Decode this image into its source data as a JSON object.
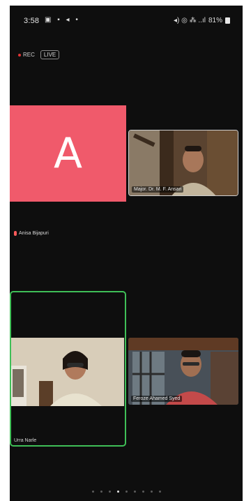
{
  "status_bar": {
    "time": "3:58",
    "left_icons": "▣ ▪ ◂ •",
    "right_icons": "◂) ◎ ⁂ ..ıl",
    "battery": "81%"
  },
  "recording": {
    "rec_label": "REC",
    "live_label": "LIVE"
  },
  "participants": {
    "avatar_tile": {
      "letter": "A",
      "name": "Anisa Bijapuri",
      "color": "#f05a6b"
    },
    "video_tile_top_right": {
      "name": "Major. Dr. M. F. Ansari"
    },
    "video_tile_bottom_left": {
      "name": "Urra Narle"
    },
    "video_tile_bottom_right": {
      "name": "Feroze Ahamed Syed"
    }
  },
  "colors": {
    "active_speaker_border": "#3fbf57",
    "background": "#0e0e0e"
  },
  "pagination": {
    "pages": 9,
    "active_index": 3
  }
}
